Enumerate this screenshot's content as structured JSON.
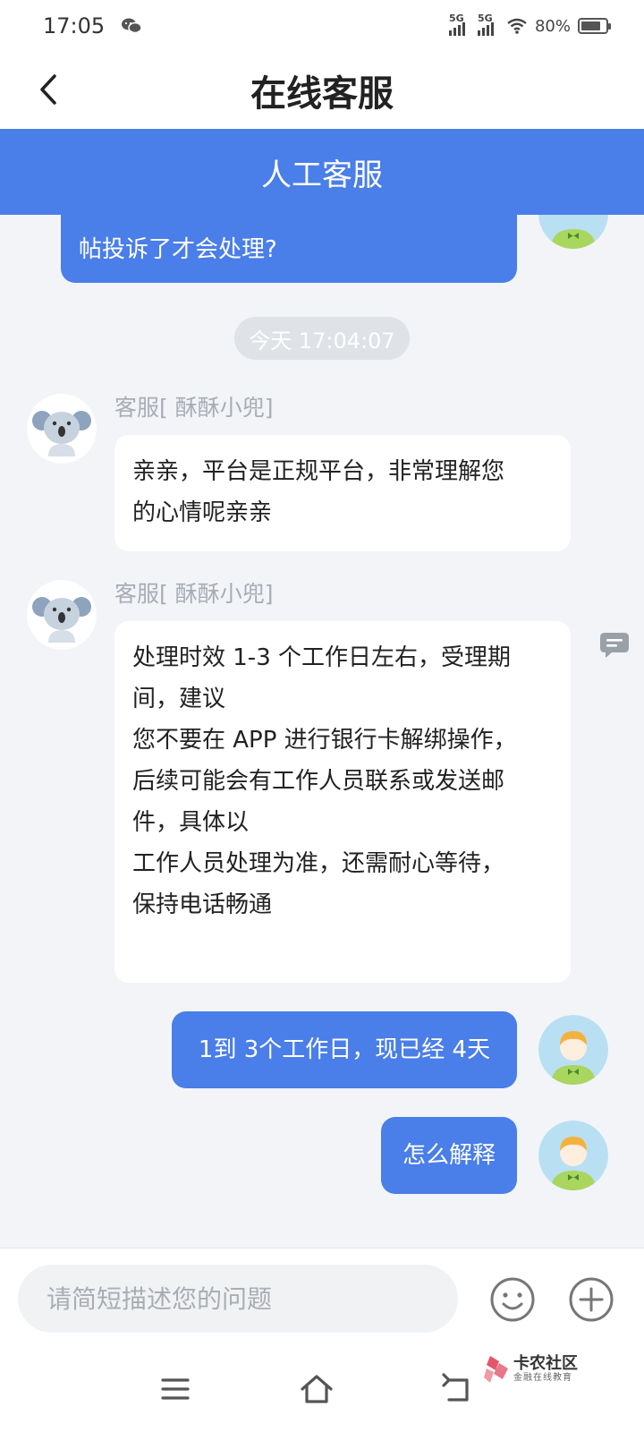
{
  "status_bar": {
    "time": "17:05",
    "network_1": "5G",
    "network_2": "5G",
    "battery": "80%",
    "battery_level": 0.8
  },
  "header": {
    "title": "在线客服",
    "banner": "人工客服"
  },
  "chat": {
    "partial_message": "帖投诉了才会处理?",
    "timestamp": "今天 17:04:07",
    "messages": [
      {
        "sender": "agent",
        "name": "客服[ 酥酥小兜]",
        "lines": [
          "亲亲，平台是正规平台，非常理解您",
          "的心情呢亲亲"
        ]
      },
      {
        "sender": "agent",
        "name": "客服[ 酥酥小兜]",
        "lines": [
          "处理时效 1-3 个工作日左右，受理期",
          "间，建议",
          "您不要在 APP 进行银行卡解绑操作，",
          "后续可能会有工作人员联系或发送邮",
          "件，具体以",
          "工作人员处理为准，还需耐心等待，",
          "保持电话畅通"
        ]
      },
      {
        "sender": "user",
        "text": "1到 3个工作日，现已经 4天"
      },
      {
        "sender": "user",
        "text": "怎么解释"
      }
    ]
  },
  "input": {
    "placeholder": "请简短描述您的问题"
  },
  "watermark": {
    "main": "卡农社区",
    "sub": "金融在线教育"
  },
  "icons": {
    "back": "chevron-left-icon",
    "emoji": "smiley-icon",
    "plus": "plus-circle-icon",
    "chat_side": "chat-bubble-icon",
    "nav": [
      "menu-icon",
      "home-icon",
      "back-arrow-icon"
    ]
  },
  "colors": {
    "accent": "#4a7ee8",
    "background": "#f2f4f8"
  }
}
